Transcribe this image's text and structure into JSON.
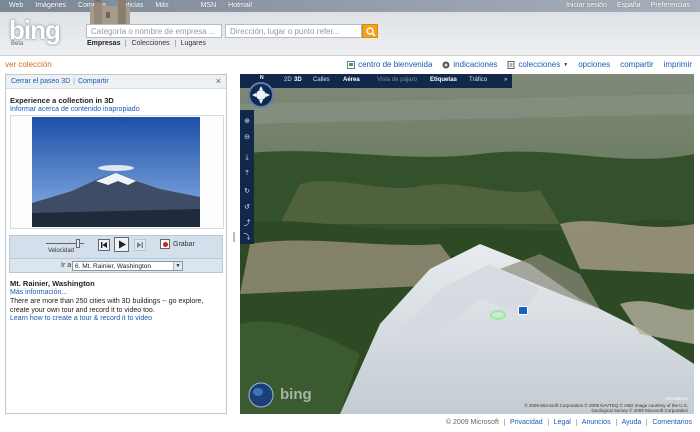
{
  "header": {
    "topnav_left": [
      "Web",
      "Imágenes",
      "Compras",
      "Noticias",
      "Más",
      "MSN",
      "Hotmail"
    ],
    "topnav_right": [
      "Iniciar sesión",
      "España",
      "Preferencias"
    ],
    "logo": "bing",
    "beta": "Beta",
    "search_what_placeholder": "Categoría o nombre de empresa ...",
    "search_where_placeholder": "Dirección, lugar o punto refer...",
    "subtabs": [
      "Empresas",
      "Colecciones",
      "Lugares"
    ]
  },
  "toolbar": {
    "ver_coleccion": "ver colección",
    "items": [
      "centro de bienvenida",
      "indicaciones",
      "colecciones",
      "opciones",
      "compartir",
      "imprimir"
    ]
  },
  "panel": {
    "close_3d": "Cerrar el paseo 3D",
    "share": "Compartir",
    "close_x": "×",
    "title": "Experience a collection in 3D",
    "report": "Informar acerca de contenido inapropiado",
    "speed_label": "Velocidad",
    "record_label": "Grabar",
    "goto_label": "Ir a",
    "goto_value": "6. Mt. Rainier, Washington",
    "desc_title": "Mt. Rainier, Washington",
    "desc_more": "Más información...",
    "desc_text": "There are more than 250 cities with 3D buildings -- go explore, create your own tour and record it to video too.",
    "desc_link": "Learn how to create a tour & record it to video"
  },
  "map": {
    "bar": {
      "mode_2d": "2D",
      "mode_3d": "3D",
      "calles": "Calles",
      "aerea": "Aérea",
      "vista_pajaro": "Vista de pájaro",
      "etiquetas": "Etiquetas",
      "trafico": "Tráfico",
      "more": "»"
    },
    "north": "N",
    "watermark": "bing",
    "copyright": "© 2009 Microsoft Corporation © 2009 NAVTEQ © AND Image courtesy of the U.S. Geological Survey © 2009 Microsoft Corporation",
    "scale": "200 Metros"
  },
  "footer": [
    "© 2009 Microsoft",
    "Privacidad",
    "Legal",
    "Anuncios",
    "Ayuda",
    "Comentarios"
  ]
}
